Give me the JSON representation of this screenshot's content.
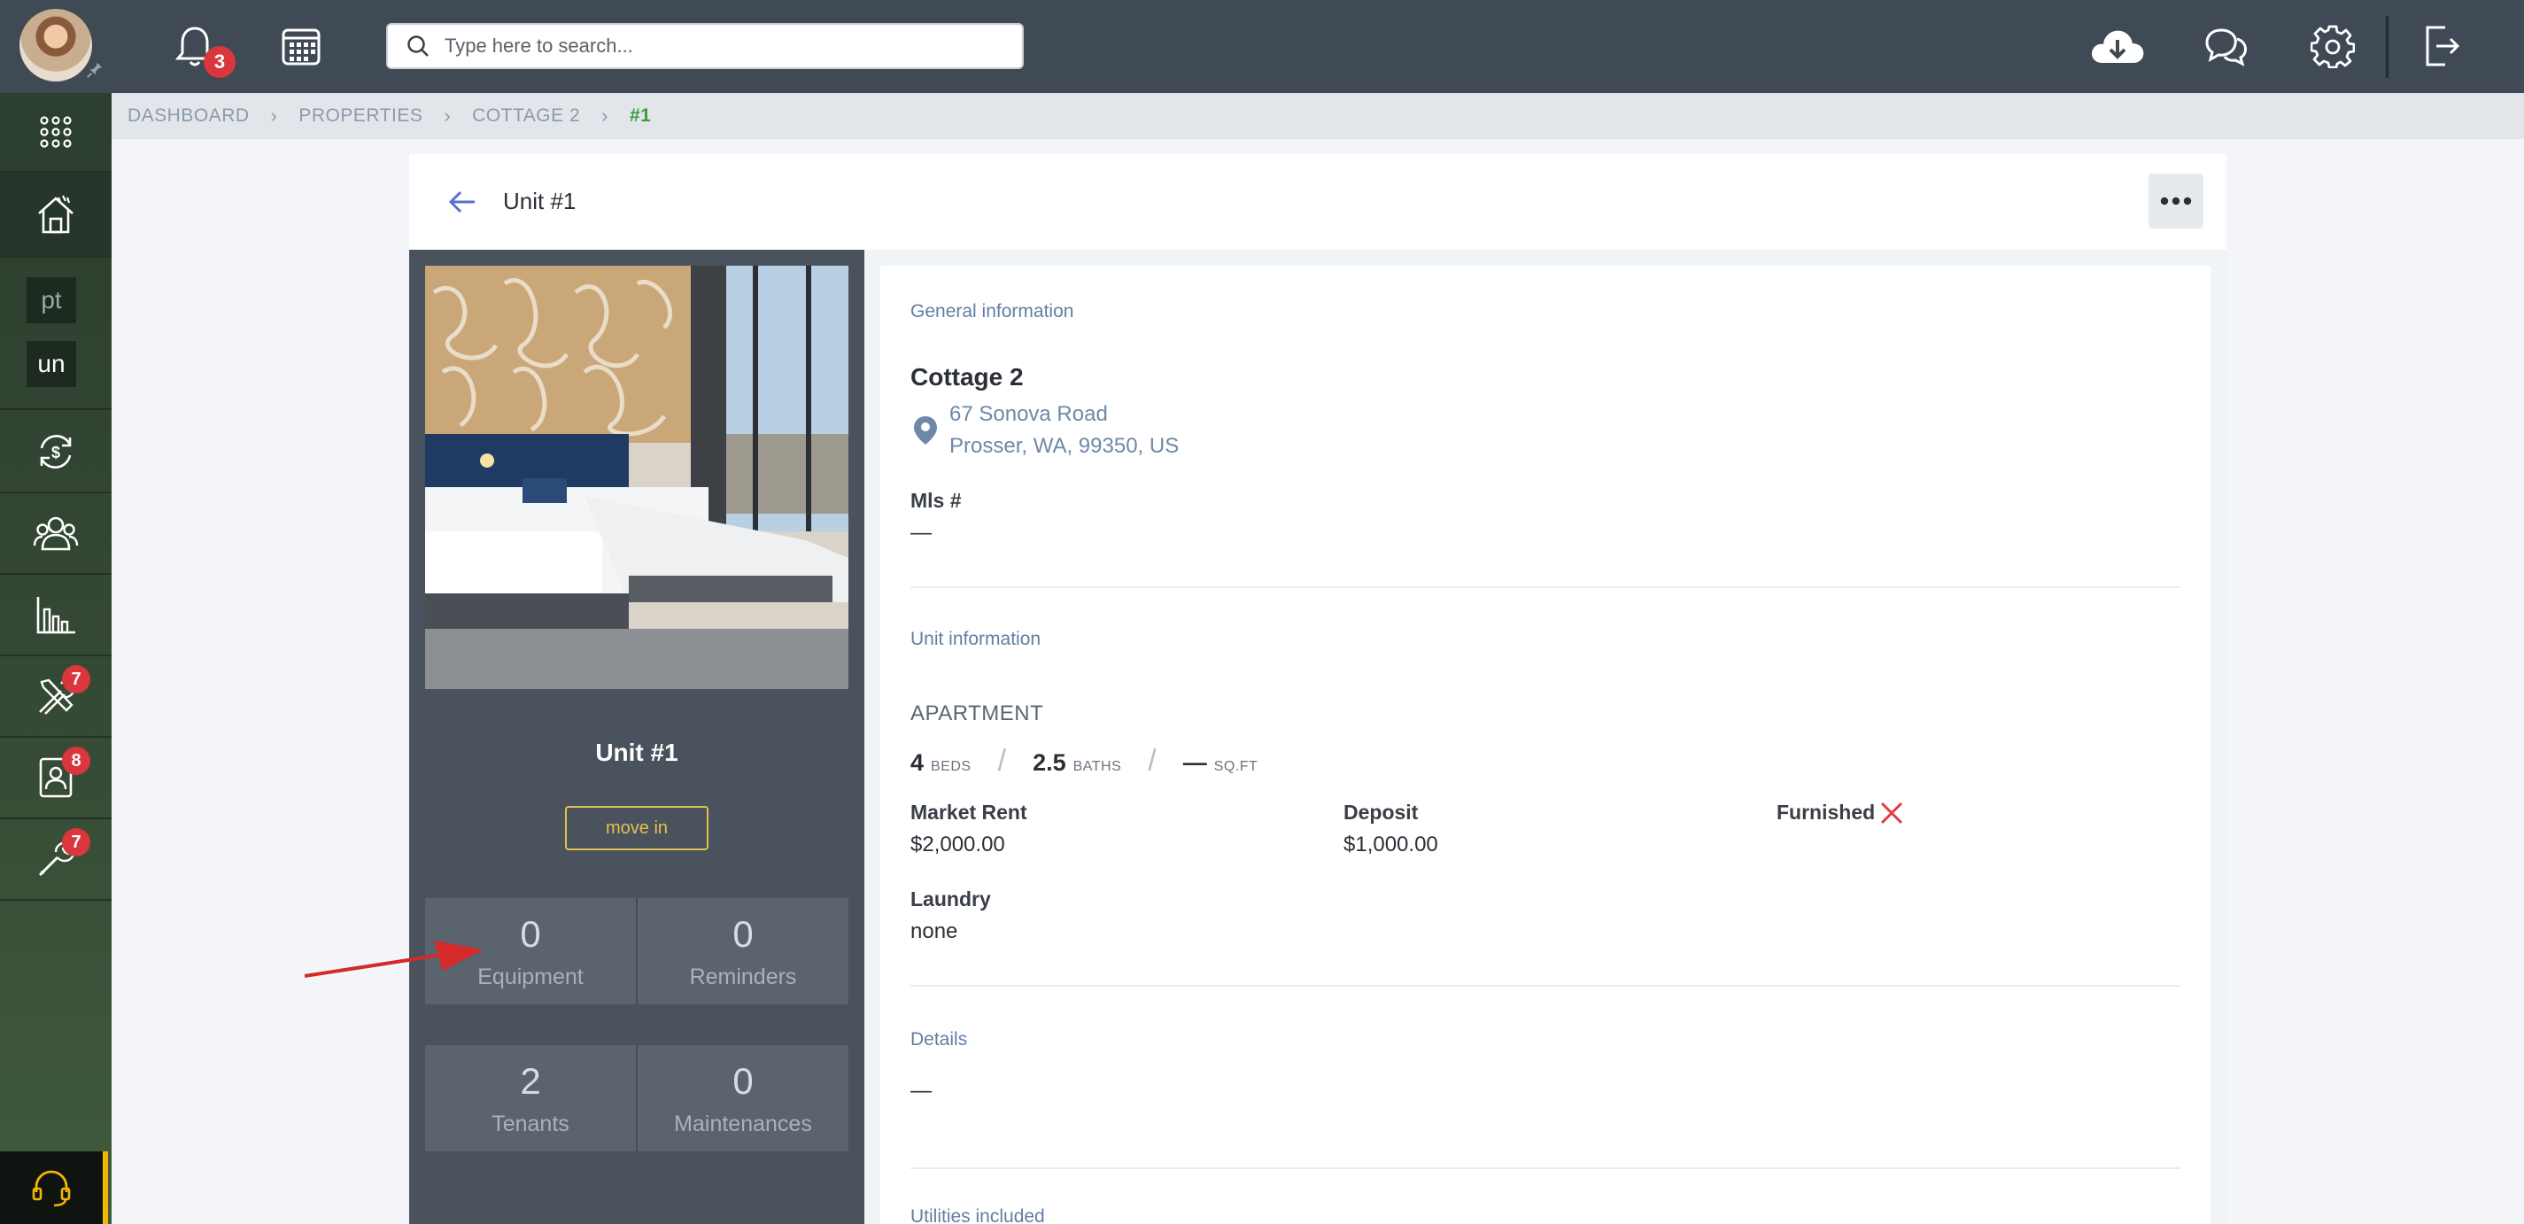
{
  "topbar": {
    "notification_count": "3",
    "search_placeholder": "Type here to search..."
  },
  "sidebar": {
    "tags": [
      "pt",
      "un"
    ],
    "badges": {
      "maintenance": "7",
      "leases": "8",
      "tools": "7"
    }
  },
  "breadcrumb": {
    "items": [
      "DASHBOARD",
      "PROPERTIES",
      "COTTAGE 2"
    ],
    "current": "#1"
  },
  "unit": {
    "title": "Unit #1",
    "name": "Unit #1",
    "move_in_label": "move in",
    "stats": [
      {
        "value": "0",
        "label": "Equipment"
      },
      {
        "value": "0",
        "label": "Reminders"
      },
      {
        "value": "2",
        "label": "Tenants"
      },
      {
        "value": "0",
        "label": "Maintenances"
      }
    ]
  },
  "general": {
    "section_title": "General information",
    "property_name": "Cottage 2",
    "address_line1": "67 Sonova Road",
    "address_line2": "Prosser, WA, 99350, US",
    "mls_label": "Mls #",
    "mls_value": "—"
  },
  "unit_info": {
    "section_title": "Unit information",
    "type": "APARTMENT",
    "beds": "4",
    "beds_unit": "BEDS",
    "baths": "2.5",
    "baths_unit": "BATHS",
    "sqft": "—",
    "sqft_unit": "SQ.FT",
    "market_rent_label": "Market Rent",
    "market_rent_value": "$2,000.00",
    "deposit_label": "Deposit",
    "deposit_value": "$1,000.00",
    "furnished_label": "Furnished",
    "furnished": false,
    "laundry_label": "Laundry",
    "laundry_value": "none"
  },
  "details": {
    "section_title": "Details",
    "value": "—"
  },
  "utilities": {
    "section_title": "Utilities included"
  },
  "colors": {
    "topbar": "#3f4a55",
    "sidebar": "#2c3e2d",
    "accent_green": "#3c9a3c",
    "badge_red": "#d9363e",
    "move_in_gold": "#e2c14a",
    "annotation_arrow": "#d42a2a"
  }
}
